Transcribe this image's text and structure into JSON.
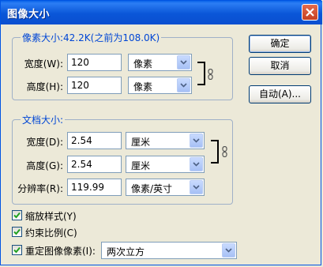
{
  "window": {
    "title": "图像大小"
  },
  "pixel_dimensions": {
    "title": "像素大小:42.2K(之前为108.0K)",
    "width_label": "宽度(W):",
    "width_value": "120",
    "width_unit": "像素",
    "height_label": "高度(H):",
    "height_value": "120",
    "height_unit": "像素"
  },
  "document_size": {
    "title": "文档大小:",
    "width_label": "宽度(D):",
    "width_value": "2.54",
    "width_unit": "厘米",
    "height_label": "高度(G):",
    "height_value": "2.54",
    "height_unit": "厘米",
    "resolution_label": "分辨率(R):",
    "resolution_value": "119.99",
    "resolution_unit": "像素/英寸"
  },
  "buttons": {
    "ok": "确定",
    "cancel": "取消",
    "auto": "自动(A)..."
  },
  "options": {
    "scale_styles": "缩放样式(Y)",
    "scale_styles_checked": true,
    "constrain_proportions": "约束比例(C)",
    "constrain_proportions_checked": true,
    "resample_image": "重定图像像素(I):",
    "resample_image_checked": true,
    "resample_method": "两次立方"
  },
  "colors": {
    "titlebar": "#0a56d8",
    "group_title": "#0046d5",
    "dialog_bg": "#ece9d8"
  }
}
